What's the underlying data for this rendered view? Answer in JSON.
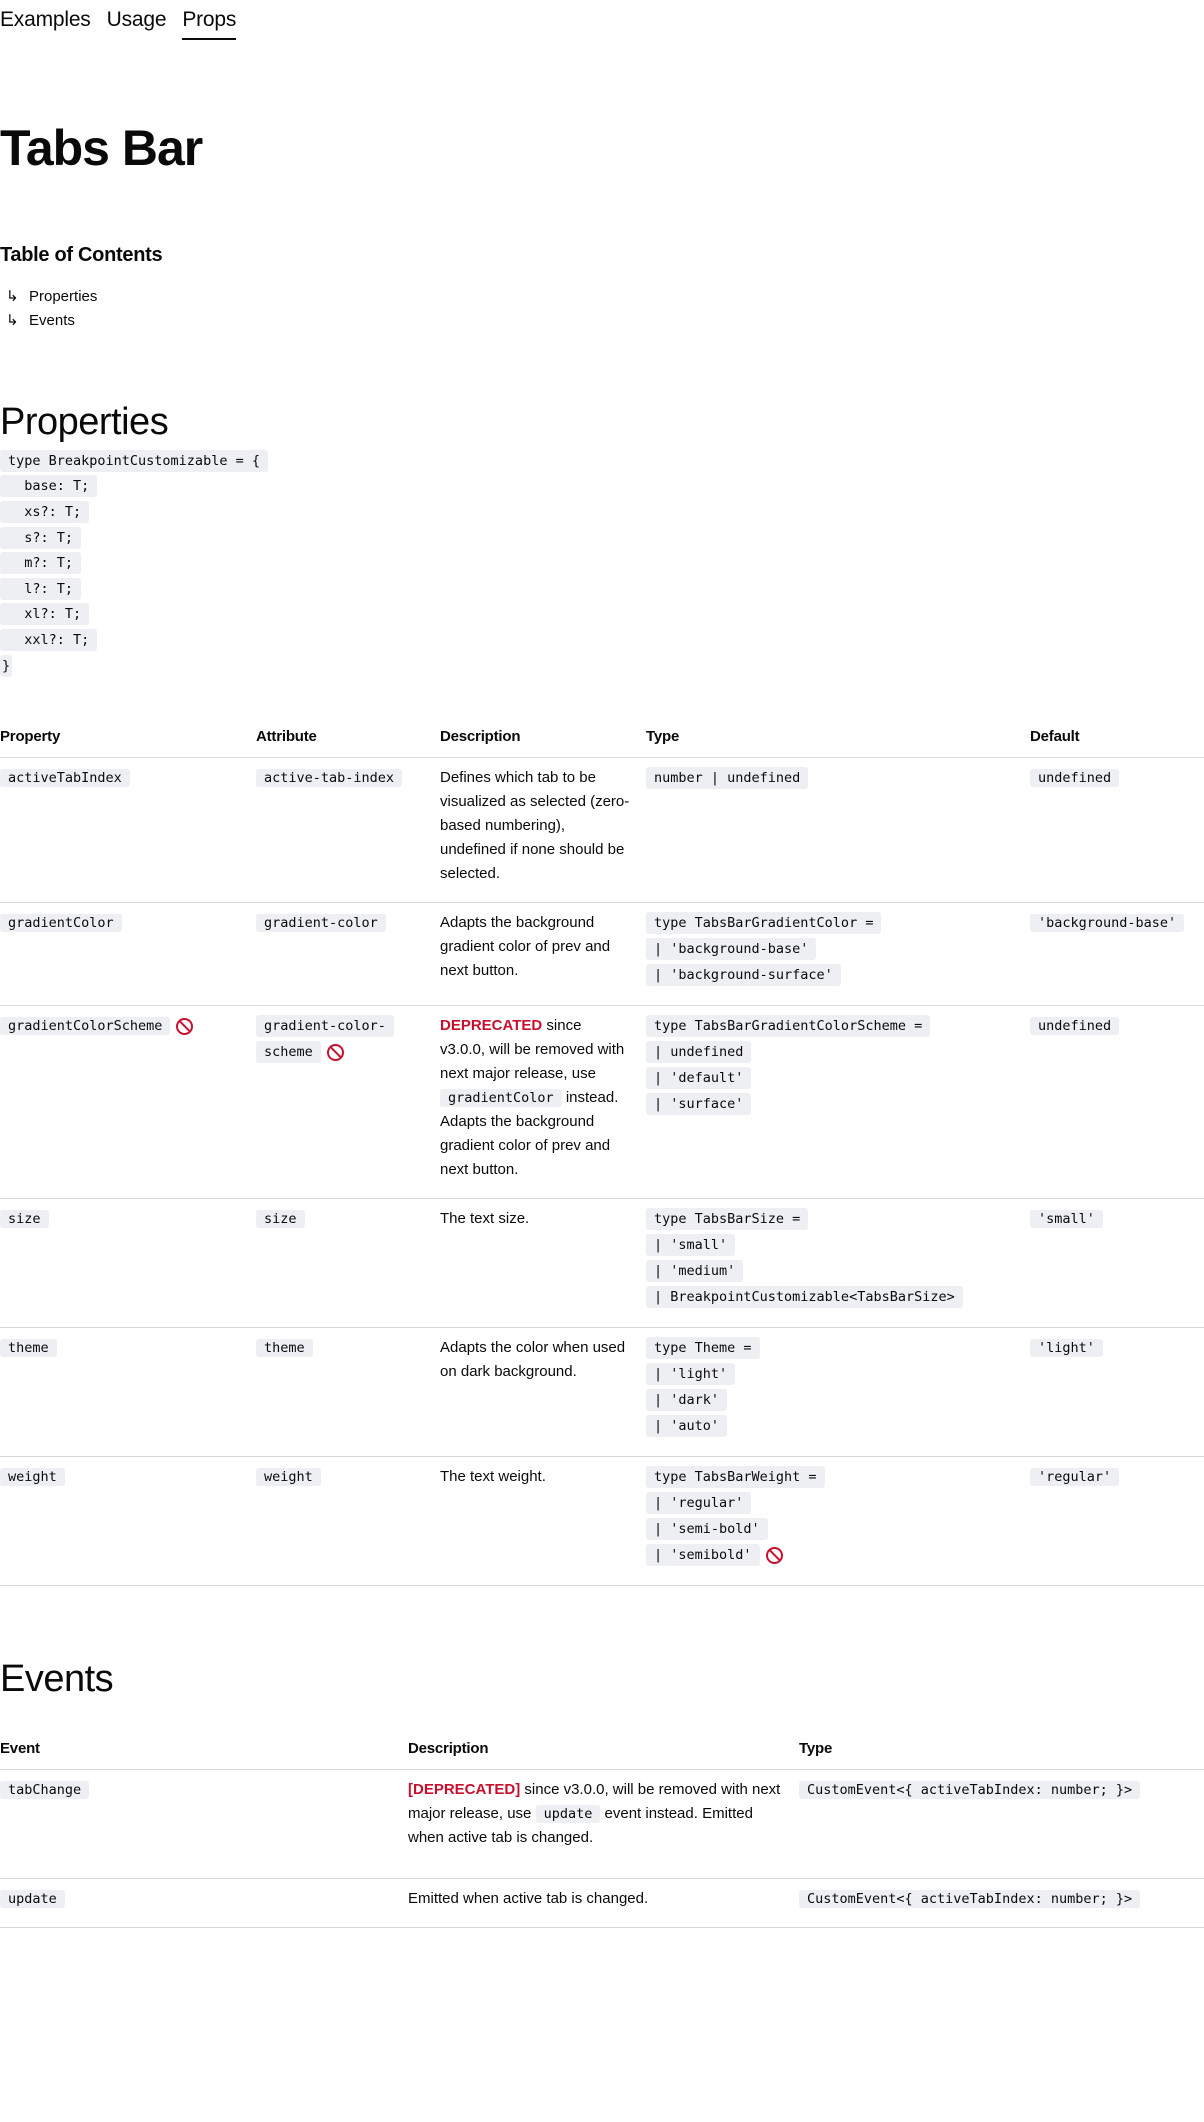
{
  "tabs": [
    {
      "label": "Examples",
      "active": false
    },
    {
      "label": "Usage",
      "active": false
    },
    {
      "label": "Props",
      "active": true
    }
  ],
  "page_title": "Tabs Bar",
  "toc": {
    "title": "Table of Contents",
    "arrow": "↳",
    "items": [
      "Properties",
      "Events"
    ]
  },
  "properties": {
    "heading": "Properties",
    "type_block": [
      "type BreakpointCustomizable = {",
      "  base: T;",
      "  xs?: T;",
      "  s?: T;",
      "  m?: T;",
      "  l?: T;",
      "  xl?: T;",
      "  xxl?: T;",
      "}"
    ],
    "columns": [
      "Property",
      "Attribute",
      "Description",
      "Type",
      "Default"
    ],
    "rows": [
      {
        "property": "activeTabIndex",
        "attribute": [
          "active-tab-index"
        ],
        "description": "Defines which tab to be visualized as selected (zero-based numbering), undefined if none should be selected.",
        "type": [
          "number | undefined"
        ],
        "default": "undefined"
      },
      {
        "property": "gradientColor",
        "attribute": [
          "gradient-color"
        ],
        "description": "Adapts the background gradient color of prev and next button.",
        "type": [
          "type TabsBarGradientColor =",
          "| 'background-base'",
          "| 'background-surface'"
        ],
        "default": "'background-base'"
      },
      {
        "property": "gradientColorScheme",
        "attribute": [
          "gradient-color-",
          "scheme"
        ],
        "deprecated_label": "DEPRECATED",
        "description_pre": " since v3.0.0, will be removed with next major release, use ",
        "description_code": "gradientColor",
        "description_post": " instead. Adapts the background gradient color of prev and next button.",
        "type": [
          "type TabsBarGradientColorScheme =",
          "| undefined",
          "| 'default'",
          "| 'surface'"
        ],
        "default": "undefined"
      },
      {
        "property": "size",
        "attribute": [
          "size"
        ],
        "description": "The text size.",
        "type": [
          "type TabsBarSize =",
          "| 'small'",
          "| 'medium'",
          "| BreakpointCustomizable<TabsBarSize>"
        ],
        "default": "'small'"
      },
      {
        "property": "theme",
        "attribute": [
          "theme"
        ],
        "description": "Adapts the color when used on dark background.",
        "type": [
          "type Theme =",
          "| 'light'",
          "| 'dark'",
          "| 'auto'"
        ],
        "default": "'light'"
      },
      {
        "property": "weight",
        "attribute": [
          "weight"
        ],
        "description": "The text weight.",
        "type": [
          "type TabsBarWeight =",
          "| 'regular'",
          "| 'semi-bold'",
          "| 'semibold'"
        ],
        "default": "'regular'"
      }
    ]
  },
  "events": {
    "heading": "Events",
    "columns": [
      "Event",
      "Description",
      "Type"
    ],
    "rows": [
      {
        "event": "tabChange",
        "deprecated_label": "[DEPRECATED]",
        "description_pre": " since v3.0.0, will be removed with next major release, use ",
        "description_code": "update",
        "description_post": " event instead. Emitted when active tab is changed.",
        "type": "CustomEvent<{ activeTabIndex: number; }>"
      },
      {
        "event": "update",
        "description": "Emitted when active tab is changed.",
        "type": "CustomEvent<{ activeTabIndex: number; }>"
      }
    ]
  },
  "colors": {
    "deprecated": "#c8102e",
    "code_bg": "#eeeff2",
    "divider": "#d8d8db"
  },
  "icons": {
    "deprecated": "not-allowed-icon"
  }
}
